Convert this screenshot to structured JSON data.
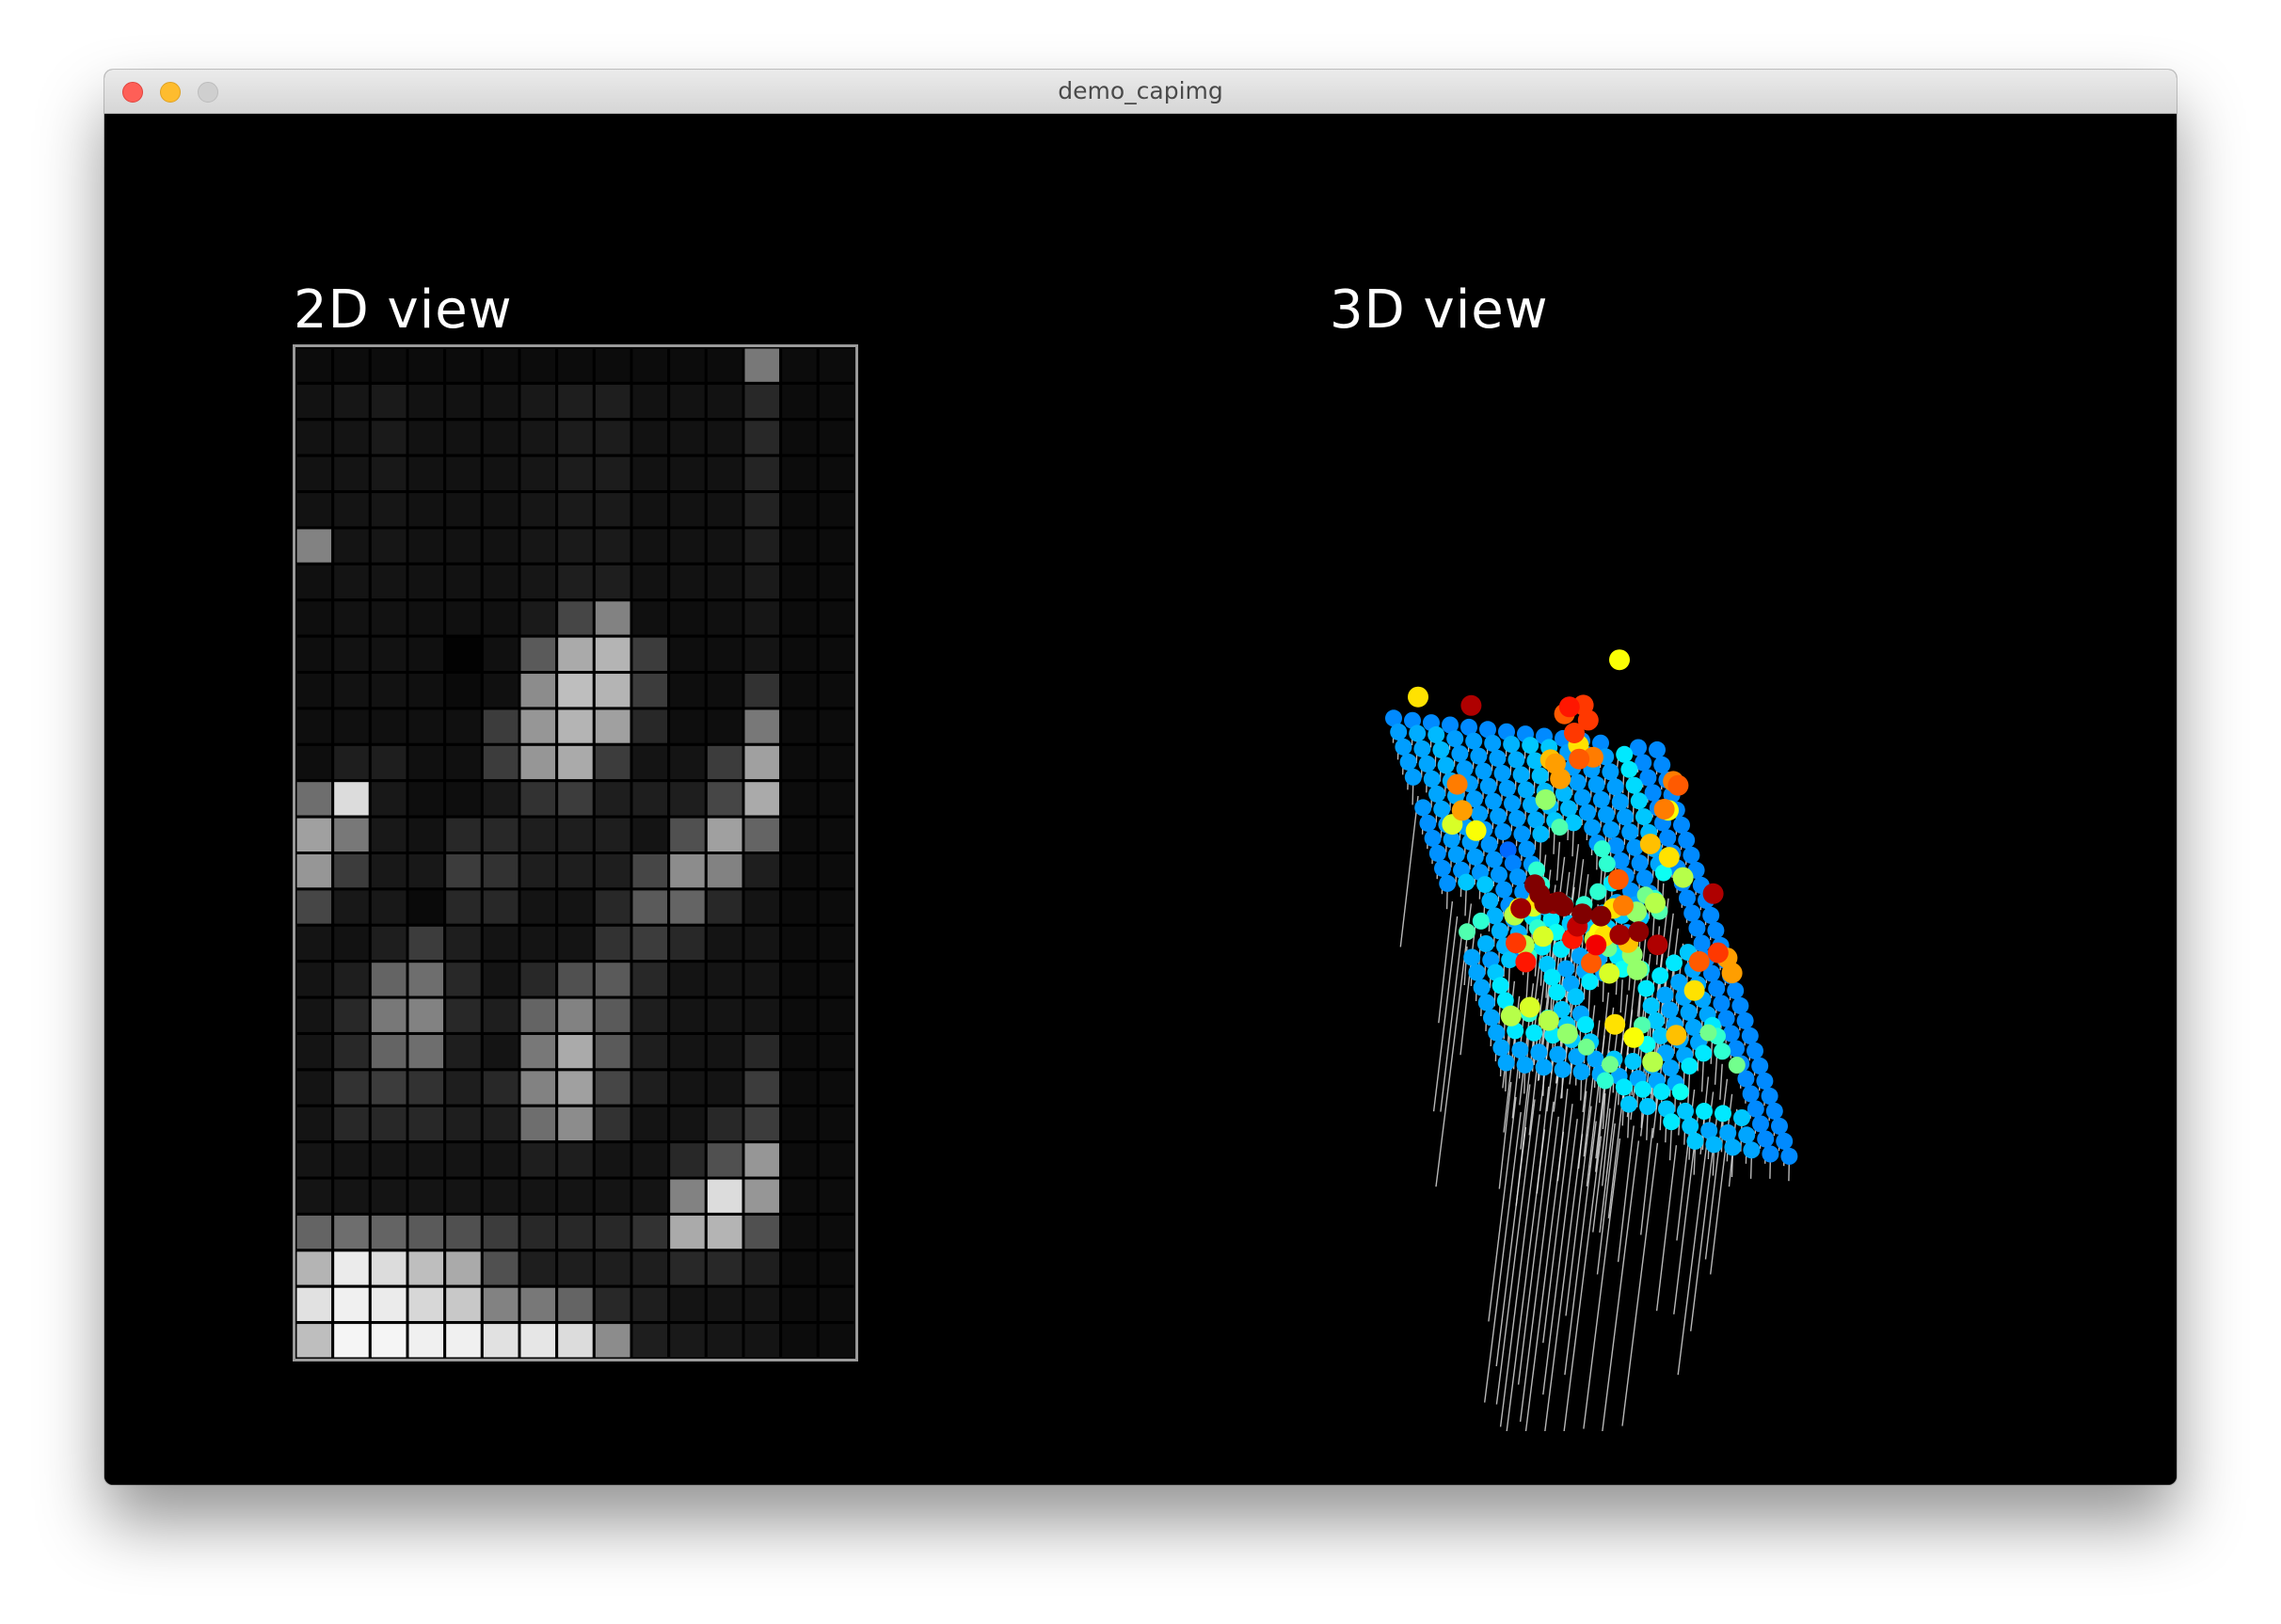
{
  "window": {
    "title": "demo_capimg"
  },
  "views": {
    "left_title": "2D view",
    "right_title": "3D view"
  },
  "colors": {
    "background": "#000000",
    "grid_border": "#9a9a9a",
    "cell_outline": "#000000",
    "stem": "#e6e6e6"
  },
  "chart_data": {
    "type": "heatmap",
    "rows": 27,
    "cols": 15,
    "scale": "grayscale 0-255",
    "values": [
      [
        12,
        12,
        12,
        12,
        12,
        12,
        12,
        12,
        12,
        12,
        12,
        12,
        120,
        12,
        12
      ],
      [
        18,
        22,
        26,
        18,
        18,
        18,
        24,
        30,
        30,
        18,
        18,
        18,
        40,
        12,
        12
      ],
      [
        18,
        20,
        26,
        18,
        18,
        18,
        22,
        28,
        28,
        18,
        18,
        18,
        40,
        12,
        12
      ],
      [
        18,
        20,
        24,
        18,
        18,
        18,
        22,
        28,
        28,
        18,
        18,
        18,
        36,
        12,
        12
      ],
      [
        18,
        20,
        22,
        18,
        18,
        18,
        22,
        26,
        26,
        18,
        18,
        18,
        34,
        12,
        12
      ],
      [
        130,
        20,
        22,
        18,
        18,
        18,
        22,
        26,
        26,
        18,
        18,
        18,
        30,
        12,
        12
      ],
      [
        16,
        20,
        20,
        18,
        18,
        18,
        22,
        30,
        30,
        18,
        18,
        18,
        26,
        12,
        12
      ],
      [
        14,
        18,
        18,
        16,
        16,
        16,
        26,
        70,
        130,
        16,
        14,
        16,
        22,
        12,
        12
      ],
      [
        14,
        18,
        18,
        16,
        2,
        16,
        90,
        170,
        180,
        60,
        14,
        14,
        20,
        12,
        12
      ],
      [
        14,
        18,
        18,
        16,
        10,
        16,
        140,
        190,
        180,
        60,
        14,
        14,
        50,
        12,
        12
      ],
      [
        14,
        16,
        16,
        16,
        16,
        60,
        150,
        180,
        160,
        40,
        14,
        14,
        120,
        12,
        12
      ],
      [
        14,
        30,
        30,
        16,
        16,
        60,
        150,
        170,
        60,
        20,
        20,
        60,
        160,
        12,
        12
      ],
      [
        110,
        220,
        24,
        14,
        14,
        24,
        50,
        60,
        30,
        30,
        30,
        70,
        170,
        12,
        12
      ],
      [
        160,
        120,
        24,
        18,
        40,
        40,
        30,
        30,
        30,
        20,
        80,
        160,
        100,
        12,
        12
      ],
      [
        150,
        60,
        24,
        24,
        60,
        50,
        30,
        30,
        30,
        70,
        140,
        130,
        30,
        12,
        12
      ],
      [
        70,
        24,
        24,
        10,
        40,
        40,
        20,
        20,
        40,
        90,
        100,
        40,
        20,
        12,
        12
      ],
      [
        20,
        18,
        30,
        60,
        30,
        20,
        20,
        20,
        50,
        60,
        40,
        20,
        20,
        12,
        12
      ],
      [
        20,
        30,
        100,
        110,
        40,
        20,
        40,
        80,
        90,
        40,
        20,
        20,
        20,
        12,
        12
      ],
      [
        20,
        40,
        120,
        130,
        40,
        30,
        100,
        130,
        90,
        30,
        20,
        20,
        20,
        12,
        12
      ],
      [
        20,
        40,
        100,
        110,
        30,
        20,
        120,
        170,
        90,
        30,
        20,
        20,
        40,
        12,
        12
      ],
      [
        20,
        50,
        60,
        50,
        30,
        40,
        130,
        160,
        70,
        30,
        20,
        20,
        60,
        12,
        12
      ],
      [
        20,
        40,
        40,
        40,
        30,
        30,
        110,
        140,
        50,
        20,
        20,
        40,
        60,
        12,
        12
      ],
      [
        20,
        20,
        20,
        20,
        20,
        20,
        30,
        30,
        20,
        20,
        40,
        80,
        150,
        12,
        12
      ],
      [
        20,
        20,
        20,
        20,
        20,
        20,
        20,
        20,
        20,
        20,
        130,
        220,
        150,
        12,
        12
      ],
      [
        100,
        110,
        100,
        90,
        80,
        60,
        40,
        40,
        40,
        50,
        170,
        180,
        80,
        12,
        12
      ],
      [
        180,
        235,
        220,
        190,
        170,
        80,
        30,
        30,
        30,
        30,
        40,
        40,
        30,
        12,
        12
      ],
      [
        225,
        240,
        235,
        215,
        200,
        130,
        120,
        100,
        40,
        30,
        20,
        20,
        20,
        12,
        12
      ],
      [
        190,
        245,
        245,
        240,
        240,
        225,
        230,
        220,
        140,
        30,
        25,
        22,
        20,
        12,
        12
      ]
    ]
  }
}
